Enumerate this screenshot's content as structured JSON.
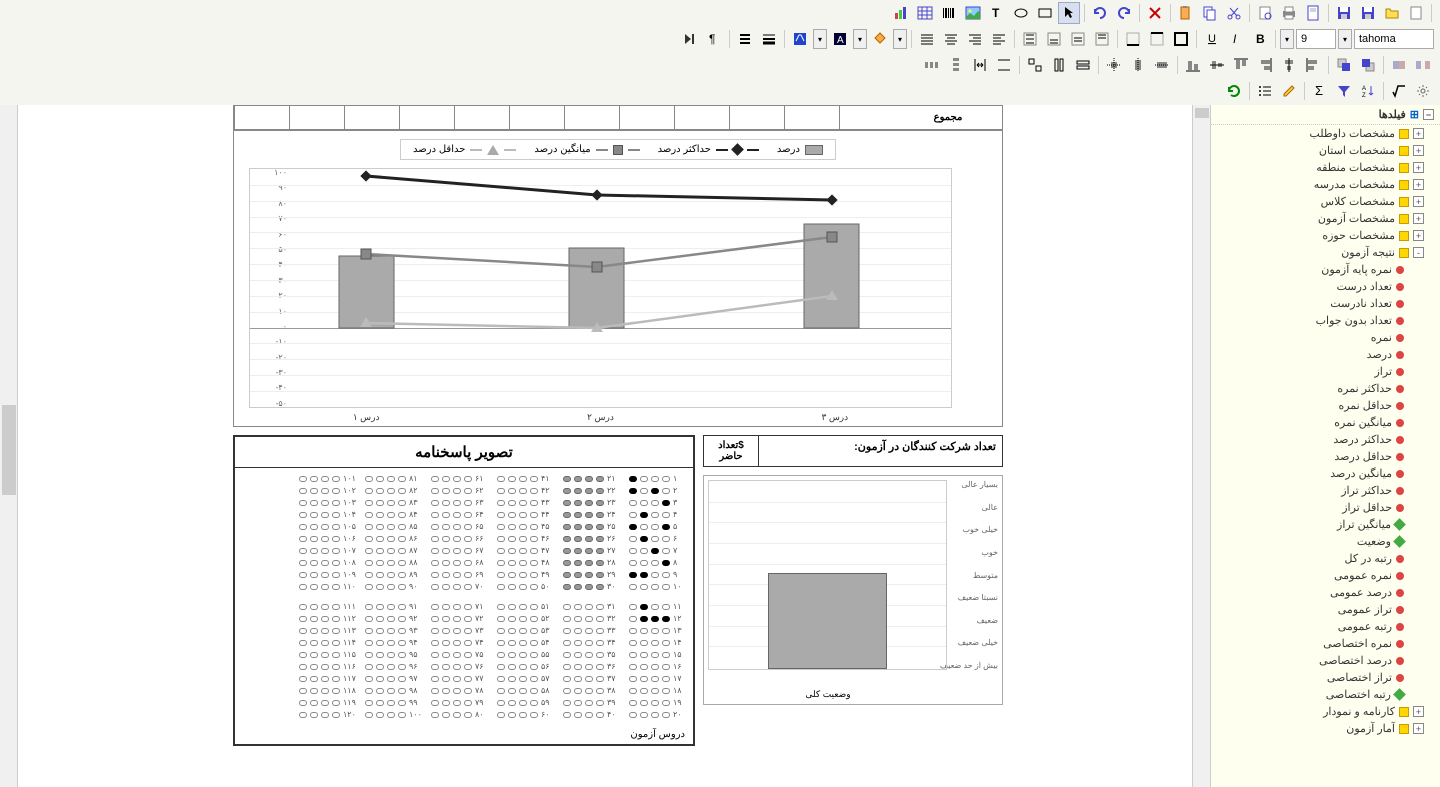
{
  "toolbar": {
    "font_name": "tahoma",
    "font_size": "9"
  },
  "fields_panel": {
    "header": "فیلدها",
    "items": [
      {
        "label": "مشخصات داوطلب",
        "type": "folder",
        "level": 1,
        "expand": "+"
      },
      {
        "label": "مشخصات استان",
        "type": "folder",
        "level": 1,
        "expand": "+"
      },
      {
        "label": "مشخصات منطقه",
        "type": "folder",
        "level": 1,
        "expand": "+"
      },
      {
        "label": "مشخصات مدرسه",
        "type": "folder",
        "level": 1,
        "expand": "+"
      },
      {
        "label": "مشخصات کلاس",
        "type": "folder",
        "level": 1,
        "expand": "+"
      },
      {
        "label": "مشخصات آزمون",
        "type": "folder",
        "level": 1,
        "expand": "+"
      },
      {
        "label": "مشخصات حوزه",
        "type": "folder",
        "level": 1,
        "expand": "+"
      },
      {
        "label": "نتیجه آزمون",
        "type": "folder",
        "level": 1,
        "expand": "-"
      },
      {
        "label": "نمره پایه آزمون",
        "type": "red",
        "level": 2
      },
      {
        "label": "تعداد درست",
        "type": "red",
        "level": 2
      },
      {
        "label": "تعداد نادرست",
        "type": "red",
        "level": 2
      },
      {
        "label": "تعداد بدون جواب",
        "type": "red",
        "level": 2
      },
      {
        "label": "نمره",
        "type": "red",
        "level": 2
      },
      {
        "label": "درصد",
        "type": "red",
        "level": 2
      },
      {
        "label": "تراز",
        "type": "red",
        "level": 2
      },
      {
        "label": "حداکثر نمره",
        "type": "red",
        "level": 2
      },
      {
        "label": "حداقل نمره",
        "type": "red",
        "level": 2
      },
      {
        "label": "میانگین نمره",
        "type": "red",
        "level": 2
      },
      {
        "label": "حداکثر درصد",
        "type": "red",
        "level": 2
      },
      {
        "label": "حداقل درصد",
        "type": "red",
        "level": 2
      },
      {
        "label": "میانگین درصد",
        "type": "red",
        "level": 2
      },
      {
        "label": "حداکثر تراز",
        "type": "red",
        "level": 2
      },
      {
        "label": "حداقل تراز",
        "type": "red",
        "level": 2
      },
      {
        "label": "میانگین تراز",
        "type": "green",
        "level": 2
      },
      {
        "label": "وضعیت",
        "type": "green",
        "level": 2
      },
      {
        "label": "رتبه در کل",
        "type": "red",
        "level": 2
      },
      {
        "label": "نمره عمومی",
        "type": "red",
        "level": 2
      },
      {
        "label": "درصد عمومی",
        "type": "red",
        "level": 2
      },
      {
        "label": "تراز عمومی",
        "type": "red",
        "level": 2
      },
      {
        "label": "رتبه عمومی",
        "type": "red",
        "level": 2
      },
      {
        "label": "نمره اختصاصی",
        "type": "red",
        "level": 2
      },
      {
        "label": "درصد اختصاصی",
        "type": "red",
        "level": 2
      },
      {
        "label": "تراز اختصاصی",
        "type": "red",
        "level": 2
      },
      {
        "label": "رتبه اختصاصی",
        "type": "green",
        "level": 2
      },
      {
        "label": "کارنامه و نمودار",
        "type": "folder",
        "level": 1,
        "expand": "+"
      },
      {
        "label": "آمار آزمون",
        "type": "folder",
        "level": 1,
        "expand": "+"
      }
    ]
  },
  "canvas": {
    "summary_label": "مجموع",
    "legend": {
      "percent": "درصد",
      "max_percent": "حداکثر درصد",
      "avg_percent": "میانگین درصد",
      "min_percent": "حداقل درصد"
    },
    "x_labels": [
      "درس ۱",
      "درس ۲",
      "درس ۳"
    ],
    "y_ticks": [
      "۱۰۰",
      "۹۰",
      "۸۰",
      "۷۰",
      "۶۰",
      "۵۰",
      "۴۰",
      "۳۰",
      "۲۰",
      "۱۰",
      "۰",
      "-۱۰",
      "-۲۰",
      "-۳۰",
      "-۴۰",
      "-۵۰"
    ],
    "answer_sheet_title": "تصویر پاسخنامه",
    "answer_sheet_footer": "دروس آزمون",
    "participants_label": "تعداد شرکت کنندگان در آزمون:",
    "participants_value": "$تعداد حاضر",
    "status_labels": [
      "بسیار عالی",
      "عالی",
      "خیلی خوب",
      "خوب",
      "متوسط",
      "نسبتا ضعیف",
      "ضعیف",
      "خیلی ضعیف",
      "بیش از حد ضعیف"
    ],
    "status_x_label": "وضعیت کلی"
  },
  "chart_data": [
    {
      "type": "bar+line",
      "categories": [
        "درس ۱",
        "درس ۲",
        "درس ۳"
      ],
      "series": [
        {
          "name": "درصد",
          "type": "bar",
          "values": [
            45,
            50,
            65
          ]
        },
        {
          "name": "حداکثر درصد",
          "type": "line",
          "values": [
            95,
            83,
            80
          ]
        },
        {
          "name": "میانگین درصد",
          "type": "line",
          "values": [
            46,
            38,
            57
          ]
        },
        {
          "name": "حداقل درصد",
          "type": "line",
          "values": [
            3,
            0,
            20
          ]
        }
      ],
      "ylim": [
        -50,
        100
      ],
      "ylabel": "",
      "xlabel": ""
    },
    {
      "type": "bar",
      "categories": [
        "بسیار عالی",
        "عالی",
        "خیلی خوب",
        "خوب",
        "متوسط",
        "نسبتا ضعیف",
        "ضعیف",
        "خیلی ضعیف",
        "بیش از حد ضعیف"
      ],
      "values": [
        0,
        0,
        0,
        0,
        1,
        0,
        0,
        0,
        0
      ],
      "title": "وضعیت کلی"
    }
  ]
}
